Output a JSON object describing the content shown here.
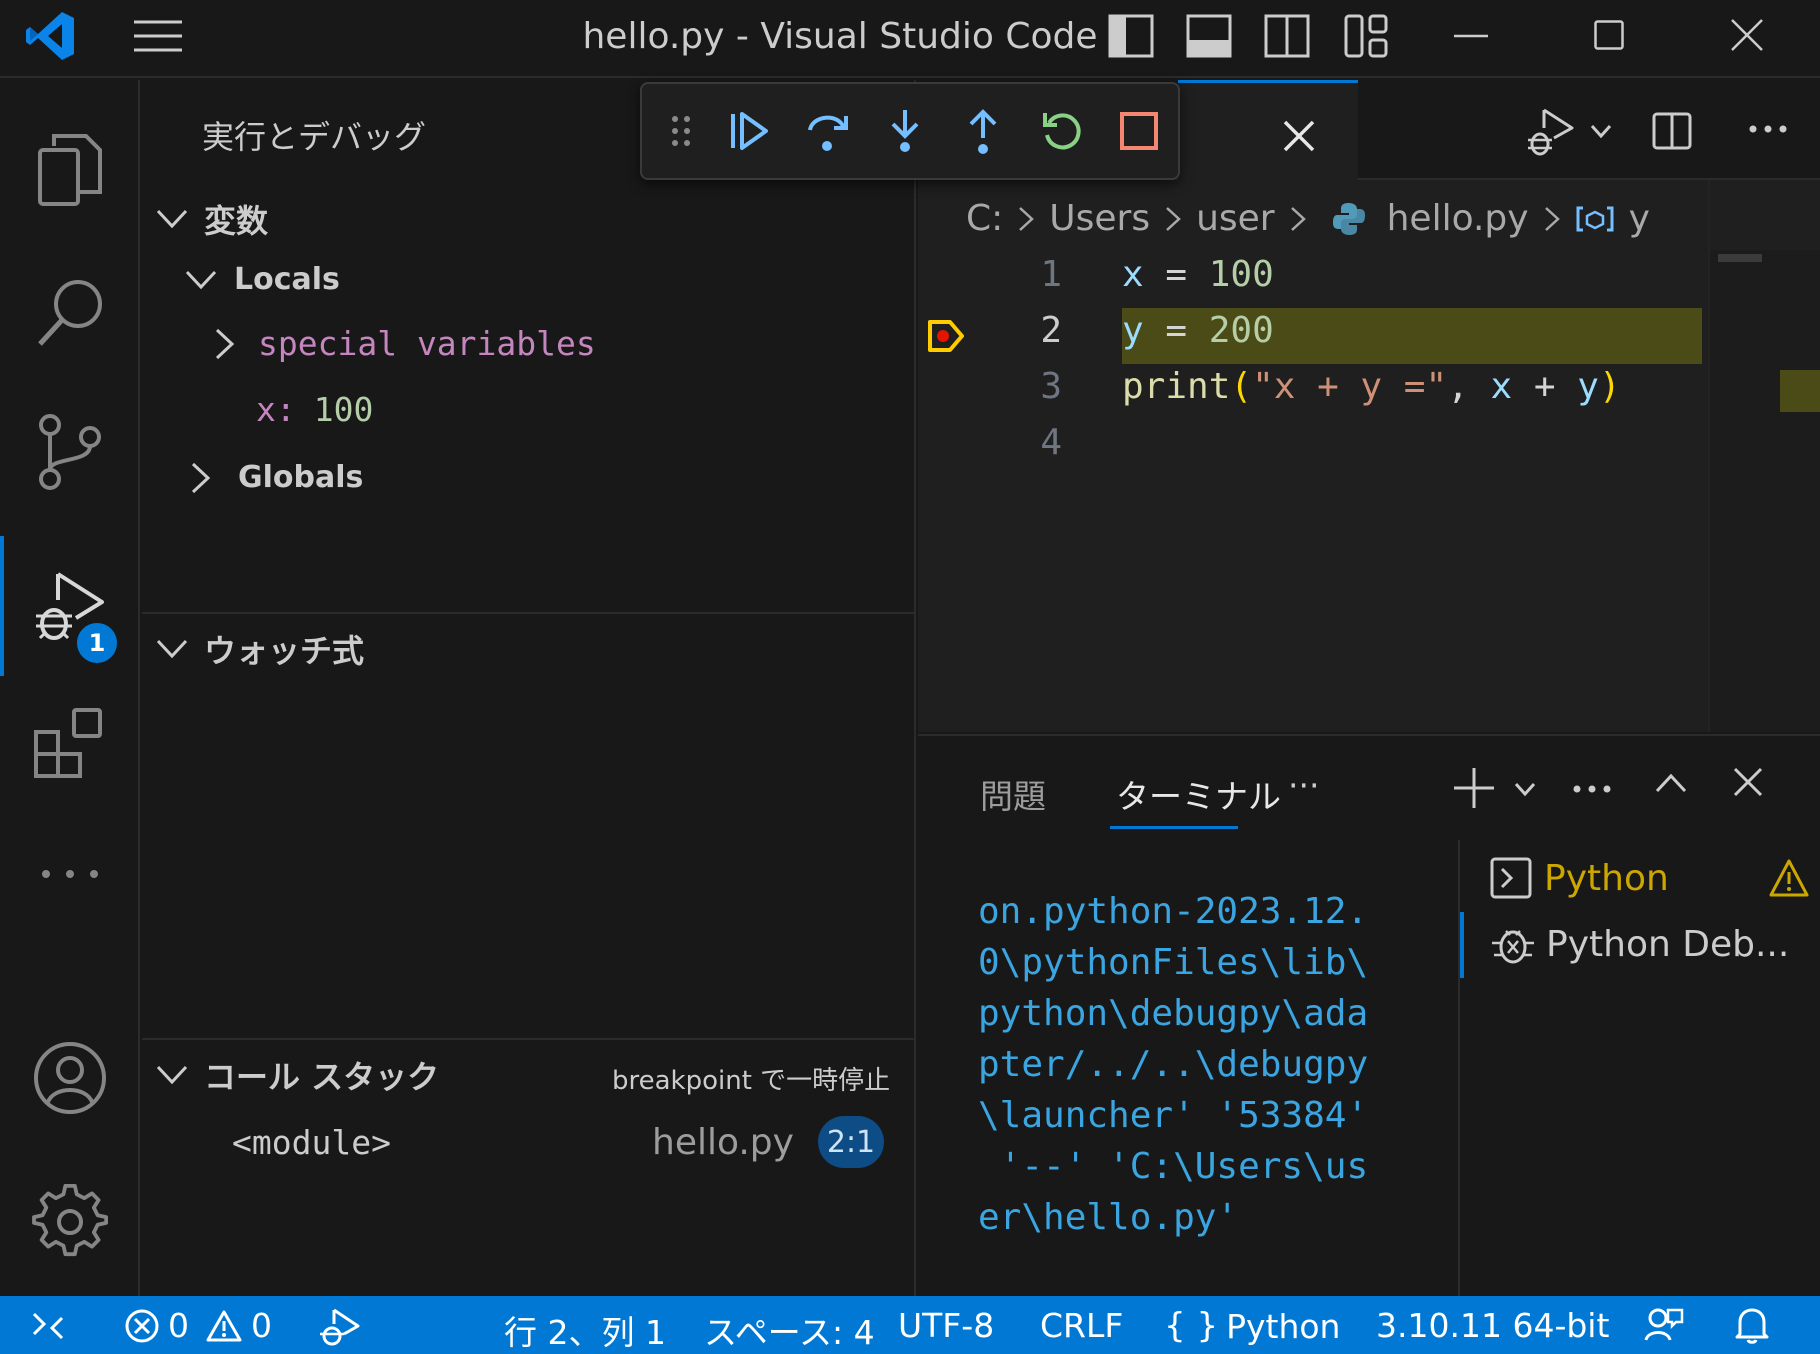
{
  "window": {
    "title": "hello.py - Visual Studio Code"
  },
  "activity_bar": {
    "debug_badge": "1"
  },
  "sidebar": {
    "title": "実行とデバッグ",
    "variables": {
      "header": "変数",
      "locals_label": "Locals",
      "special_variables": "special variables",
      "x_name": "x:",
      "x_value": "100",
      "globals_label": "Globals"
    },
    "watch": {
      "header": "ウォッチ式"
    },
    "call_stack": {
      "header": "コール スタック",
      "status": "breakpoint で一時停止",
      "frame_name": "<module>",
      "frame_file": "hello.py",
      "frame_pos": "2:1"
    }
  },
  "editor": {
    "breadcrumb": [
      "C:",
      "Users",
      "user",
      "hello.py",
      "y"
    ],
    "lines": [
      {
        "num": "1"
      },
      {
        "num": "2"
      },
      {
        "num": "3"
      },
      {
        "num": "4"
      }
    ],
    "code": {
      "l1_var": "x",
      "l1_op": "=",
      "l1_val": "100",
      "l2_var": "y",
      "l2_op": "=",
      "l2_val": "200",
      "l3_fn": "print",
      "l3_paren_open": "(",
      "l3_str": "\"x + y =\"",
      "l3_comma": ",",
      "l3_x": "x",
      "l3_plus": "+",
      "l3_y": "y",
      "l3_paren_close": ")"
    }
  },
  "panel": {
    "tabs": [
      "問題",
      "ターミナル"
    ],
    "more": "···",
    "terminal_output": "on.python-2023.12.\n0\\pythonFiles\\lib\\\npython\\debugpy\\ada\npter/../..\\debugpy\n\\launcher' '53384'\n '--' 'C:\\Users\\us\ner\\hello.py'",
    "terminal_list": [
      {
        "name": "Python"
      },
      {
        "name": "Python Deb..."
      }
    ]
  },
  "status_bar": {
    "errors": "0",
    "warnings": "0",
    "cursor": "行 2、列 1",
    "spaces": "スペース: 4",
    "encoding": "UTF-8",
    "eol": "CRLF",
    "language": "Python",
    "interpreter": "3.10.11 64-bit"
  },
  "colors": {
    "accent": "#0078d4",
    "string": "#ce9178",
    "variable": "#9cdcfe",
    "number": "#b5cea8",
    "function": "#dcdcaa",
    "special_var": "#c586c0",
    "terminal_text": "#3aa5e0",
    "warning": "#cca700"
  },
  "icons": [
    "vscode-logo",
    "menu-icon",
    "toggle-sidebar-icon",
    "toggle-panel-icon",
    "toggle-secondary-sidebar-icon",
    "customize-layout-icon",
    "minimize-icon",
    "maximize-icon",
    "close-icon",
    "explorer-icon",
    "search-icon",
    "source-control-icon",
    "run-debug-icon",
    "extensions-icon",
    "more-icon",
    "account-icon",
    "settings-icon",
    "gripper-icon",
    "continue-icon",
    "step-over-icon",
    "step-into-icon",
    "step-out-icon",
    "restart-icon",
    "stop-icon",
    "run-debug-dropdown-icon",
    "split-editor-icon",
    "python-icon",
    "symbol-variable-icon",
    "breakpoint-paused-icon",
    "new-terminal-icon",
    "chevron-up-icon",
    "terminal-icon",
    "warning-icon",
    "debug-terminal-icon",
    "remote-icon",
    "error-icon",
    "debug-status-icon",
    "braces-icon",
    "feedback-icon",
    "bell-icon"
  ]
}
